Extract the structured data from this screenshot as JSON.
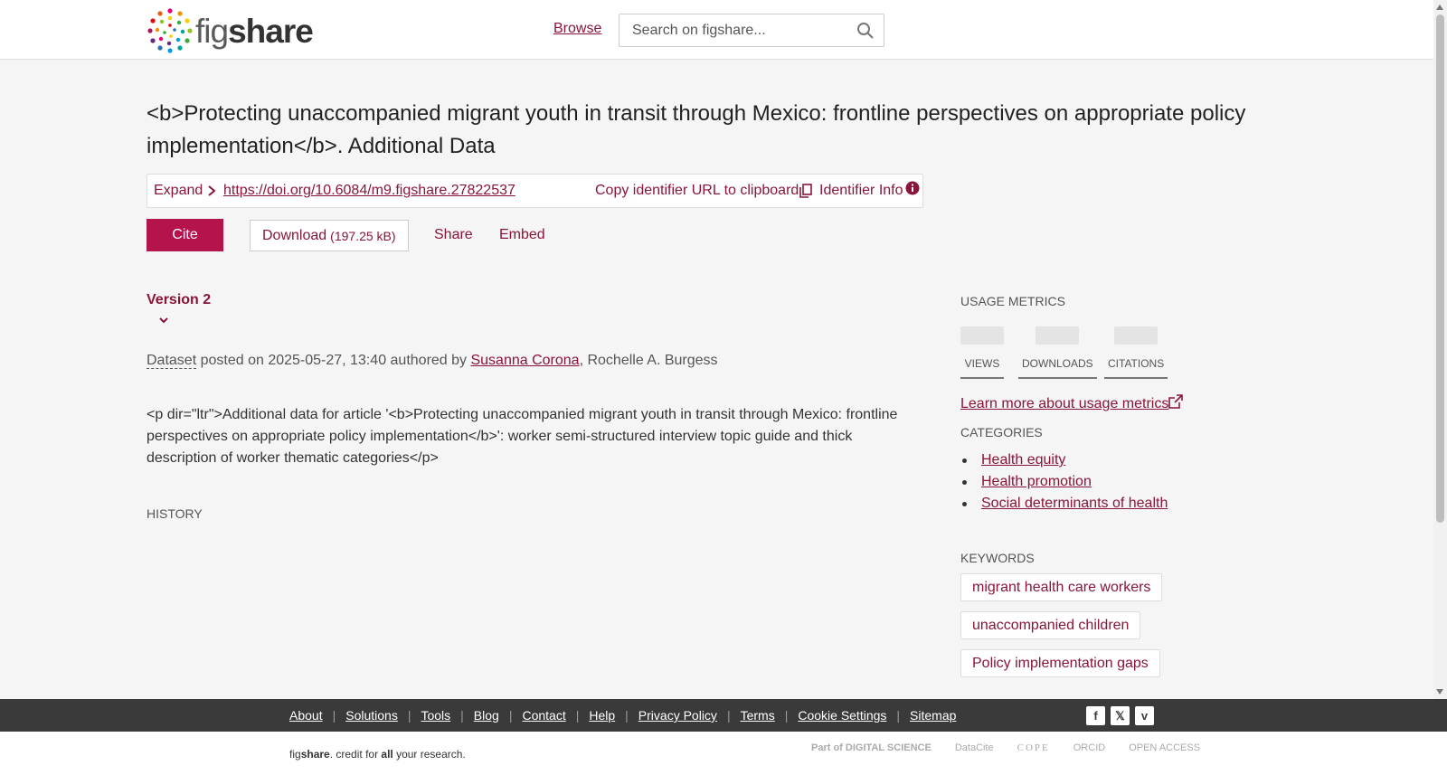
{
  "header": {
    "logo_fig": "fig",
    "logo_share": "share",
    "browse_label": "Browse",
    "search_placeholder": "Search on figshare..."
  },
  "article": {
    "title": "<b>Protecting unaccompanied migrant youth in transit through Mexico: frontline perspectives on appropriate policy implementation</b>. Additional Data",
    "expand_label": "Expand",
    "doi": "https://doi.org/10.6084/m9.figshare.27822537",
    "copy_label": "Copy identifier URL to clipboard",
    "identifier_info_label": "Identifier Info",
    "actions": {
      "cite": "Cite",
      "download": "Download",
      "download_size": "(197.25 kB)",
      "share": "Share",
      "embed": "Embed"
    },
    "version": "Version 2",
    "item_type": "Dataset",
    "posted_text": " posted on 2025-05-27, 13:40 authored by ",
    "authors": [
      "Susanna Corona",
      "Rochelle A. Burgess"
    ],
    "author_sep": ", ",
    "description": "<p dir=\"ltr\">Additional data for article '<b>Protecting unaccompanied migrant youth in transit through Mexico: frontline perspectives on appropriate policy implementation</b>': worker semi-structured interview topic guide and thick description of worker thematic categories</p>",
    "history_label": "HISTORY"
  },
  "sidebar": {
    "usage_metrics_label": "USAGE METRICS",
    "metrics": [
      "VIEWS",
      "DOWNLOADS",
      "CITATIONS"
    ],
    "learn_more": "Learn more about usage metrics",
    "categories_label": "CATEGORIES",
    "categories": [
      "Health equity",
      "Health promotion",
      "Social determinants of health"
    ],
    "keywords_label": "KEYWORDS",
    "keywords": [
      "migrant health care workers",
      "unaccompanied children",
      "Policy implementation gaps"
    ]
  },
  "footer": {
    "links": [
      "About",
      "Solutions",
      "Tools",
      "Blog",
      "Contact",
      "Help",
      "Privacy Policy",
      "Terms",
      "Cookie Settings",
      "Sitemap"
    ],
    "social": [
      "f",
      "𝕏",
      "v"
    ],
    "tagline_fig": "fig",
    "tagline_share": "share",
    "tagline_mid": ". credit for ",
    "tagline_all": "all",
    "tagline_end": " your research.",
    "partners": [
      "Part of DIGITAL SCIENCE",
      "DataCite",
      "COPE",
      "ORCID",
      "OPEN ACCESS"
    ]
  },
  "colors": {
    "accent": "#8a1538",
    "cite_button": "#b5134c",
    "footer_bar": "#3a3a3a"
  }
}
